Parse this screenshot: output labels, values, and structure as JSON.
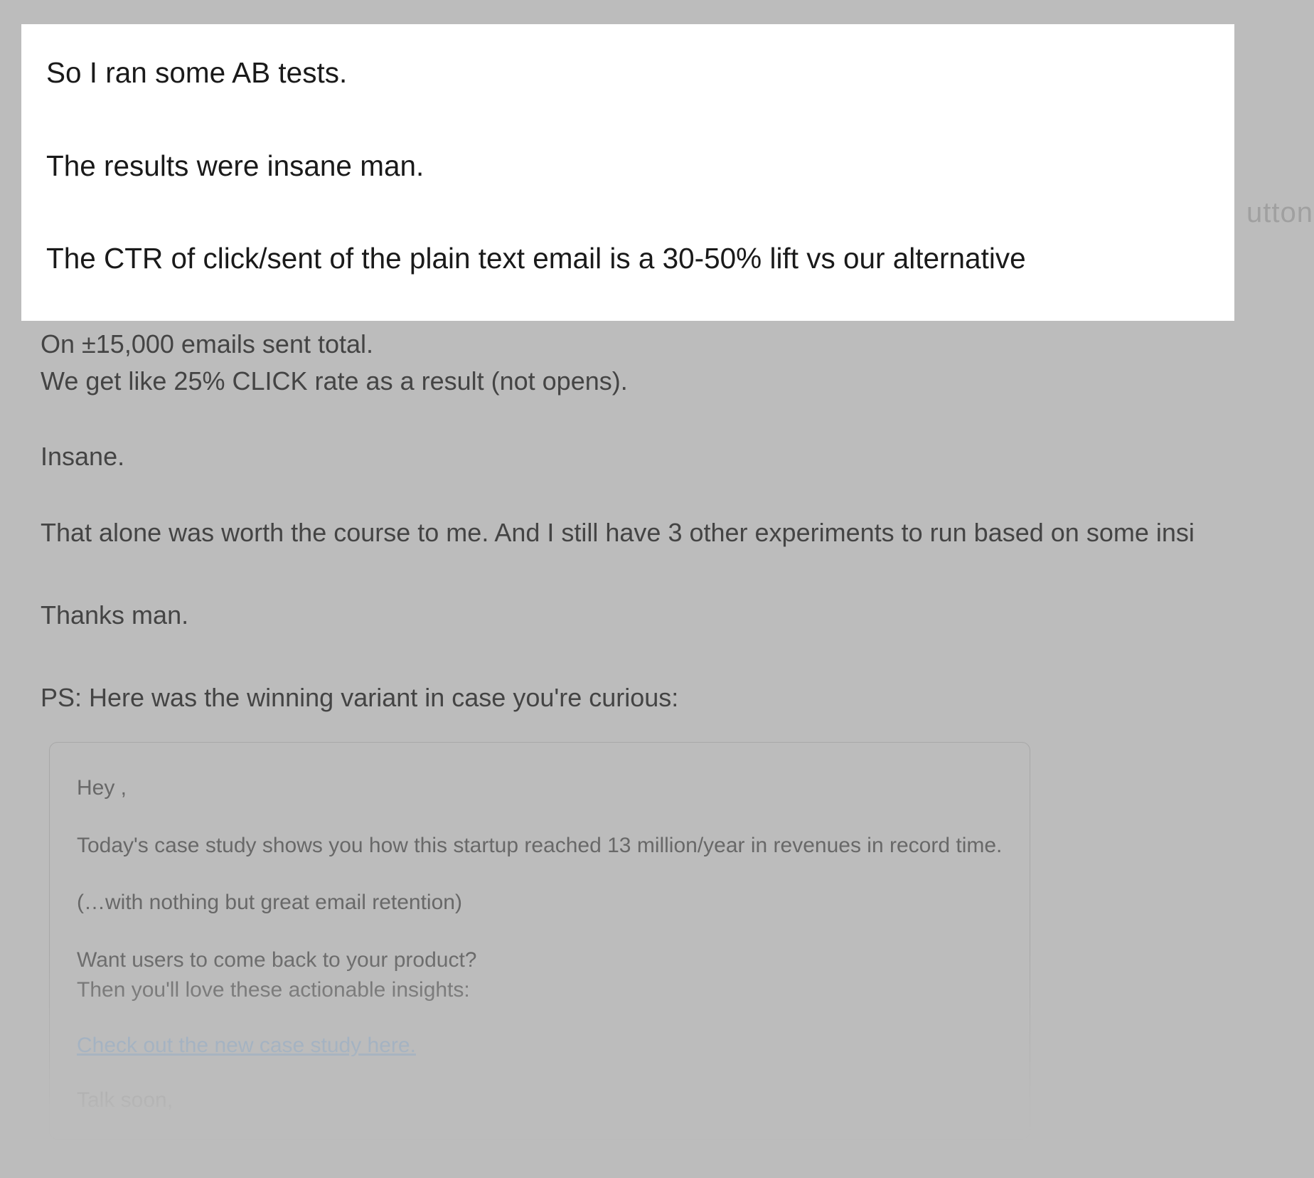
{
  "background_fragment": "uttons",
  "highlight": {
    "line1": "So I ran some AB tests.",
    "line2": "The results were insane man.",
    "line3": "The CTR of click/sent of the plain text email is a 30-50% lift vs our alternative"
  },
  "body": {
    "p1": "On ±15,000 emails sent total.",
    "p2": "We get like 25% CLICK rate as a result (not opens).",
    "p3": "Insane.",
    "p4": "That alone was worth the course to me. And I still have 3 other experiments to run based on some insi",
    "p5": "Thanks man.",
    "p6": "PS: Here was the winning variant in case you're curious:"
  },
  "quoted": {
    "greeting": "Hey ,",
    "l1": "Today's case study shows you how this startup reached 13 million/year in revenues in record time.",
    "l2": "(…with nothing but great email retention)",
    "l3": "Want users to come back to your product?",
    "l4": "Then you'll love these actionable insights:",
    "link_text": "Check out the new case study here.",
    "signoff": "Talk soon,"
  }
}
